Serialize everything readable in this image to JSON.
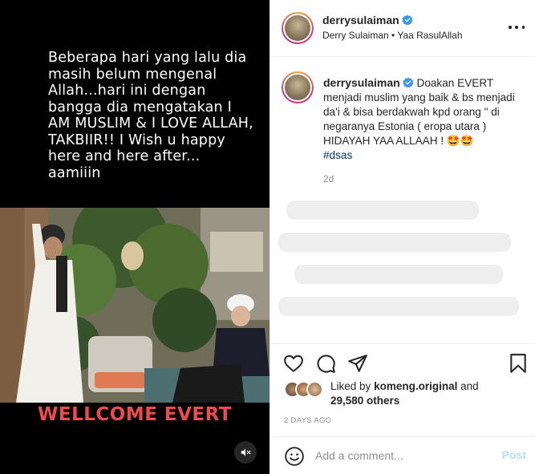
{
  "media": {
    "caption": "Beberapa hari yang lalu dia masih belum mengenal Allah...hari ini dengan bangga dia mengatakan I AM MUSLIM & I LOVE ALLAH, TAKBIIR!! I Wish u happy here and here after... aamiiin",
    "banner": "WELLCOME EVERT",
    "mute_icon": "speaker-muted-icon"
  },
  "header": {
    "username": "derrysulaiman",
    "subline": "Derry Sulaiman • Yaa RasulAllah",
    "verified_icon": "verified-badge-icon",
    "more_icon": "more-options-icon"
  },
  "caption_comment": {
    "username": "derrysulaiman",
    "text": "Doakan EVERT menjadi muslim yang baik & bs menjadi da'i & bisa berdakwah kpd orang \" di negaranya Estonia ( eropa utara ) HIDAYAH YAA ALLAAH ! 🤩🤩",
    "hashtag": "#dsas",
    "age": "2d"
  },
  "actions": {
    "like_icon": "heart-icon",
    "comment_icon": "comment-bubble-icon",
    "share_icon": "paper-plane-icon",
    "save_icon": "bookmark-icon"
  },
  "likes": {
    "prefix": "Liked by",
    "user": "komeng.original",
    "and": "and",
    "count": "29,580 others"
  },
  "date": "2 DAYS AGO",
  "add_comment": {
    "placeholder": "Add a comment...",
    "post_label": "Post",
    "emoji_icon": "emoji-smile-icon"
  },
  "colors": {
    "banner": "#f04a4f",
    "verified": "#3897f0",
    "hashtag": "#00376b",
    "post_disabled": "#b2dffc"
  }
}
